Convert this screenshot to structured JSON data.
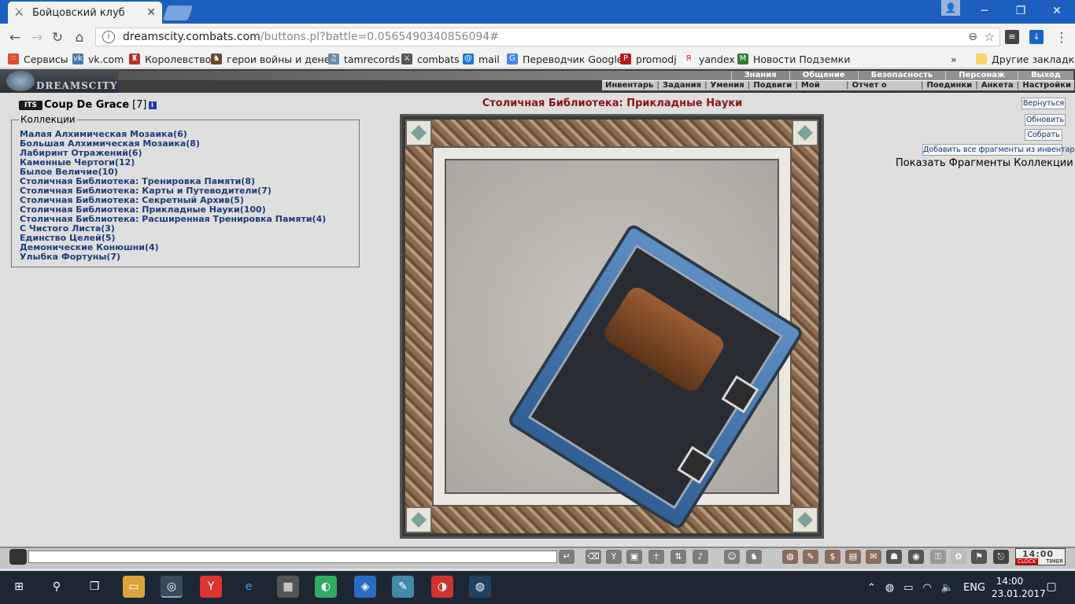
{
  "browser": {
    "tab_title": "Бойцовский клуб",
    "url_host": "dreamscity.combats.com",
    "url_path": "/buttons.pl?battle=0.0565490340856094#",
    "bookmarks": [
      {
        "label": "Сервисы",
        "icon": "apps-icon",
        "color": "#e04b2c"
      },
      {
        "label": "vk.com",
        "icon": "vk-icon",
        "color": "#4a76a8"
      },
      {
        "label": "Королевство",
        "icon": "kingdom-icon",
        "color": "#b5302a"
      },
      {
        "label": "герои войны и денег",
        "icon": "heroes-icon",
        "color": "#6b4a2a"
      },
      {
        "label": "tamrecords",
        "icon": "tamrecords-icon",
        "color": "#6a8aaa"
      },
      {
        "label": "combats",
        "icon": "combats-icon",
        "color": "#555555"
      },
      {
        "label": "mail",
        "icon": "mail-icon",
        "color": "#1976d2"
      },
      {
        "label": "Переводчик Google",
        "icon": "translate-icon",
        "color": "#4285f4"
      },
      {
        "label": "promodj",
        "icon": "promodj-icon",
        "color": "#b71c1c"
      },
      {
        "label": "yandex",
        "icon": "yandex-icon",
        "color": "#ff0000"
      },
      {
        "label": "Новости Подземки",
        "icon": "news-icon",
        "color": "#2e7d32"
      }
    ],
    "other_bookmarks": "Другие закладки"
  },
  "game": {
    "topmenu": [
      "Знания",
      "Общение",
      "Безопасность",
      "Персонаж",
      "Выход"
    ],
    "submenu": [
      "Инвентарь",
      "Задания",
      "Умения",
      "Подвиги",
      "Мой Скролл",
      "Отчет о переводах",
      "Поединки",
      "Анкета",
      "Настройки"
    ],
    "character": {
      "clan": "ITS",
      "name": "Coup De Grace",
      "level": "[7]",
      "info": "i"
    },
    "collections_legend": "Коллекции",
    "collections": [
      "Малая Алхимическая Мозаика(6)",
      "Большая Алхимическая Мозаика(8)",
      "Лабиринт Отражений(6)",
      "Каменные Чертоги(12)",
      "Былое Величие(10)",
      "Столичная Библиотека: Тренировка Памяти(8)",
      "Столичная Библиотека: Карты и Путеводители(7)",
      "Столичная Библиотека: Секретный Архив(5)",
      "Столичная Библиотека: Прикладные Науки(100)",
      "Столичная Библиотека: Расширенная Тренировка Памяти(4)",
      "С Чистого Листа(3)",
      "Единство Целей(5)",
      "Демонические Конюшни(4)",
      "Улыбка Фортуны(7)"
    ],
    "collection_title": "Столичная Библиотека: Прикладные Науки",
    "buttons": {
      "back": "Вернуться",
      "refresh": "Обновить",
      "collect": "Собрать",
      "add_all": "Добавить все фрагменты из инвентаря"
    },
    "show_fragments": "Показать Фрагменты Коллекции",
    "clock": {
      "time": "14:00",
      "clock_label": "CLOCK",
      "timer_label": "TIMER"
    }
  },
  "taskbar": {
    "lang": "ENG",
    "time": "14:00",
    "date": "23.01.2017"
  }
}
